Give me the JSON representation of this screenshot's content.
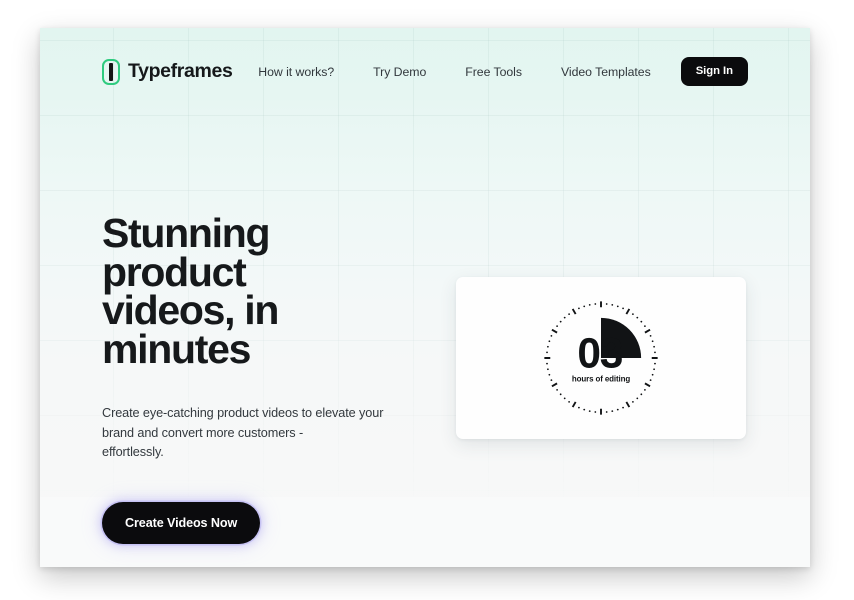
{
  "brand": {
    "name": "Typeframes",
    "logo_icon": "bracket-logo-icon",
    "logo_color": "#2fcb7f"
  },
  "nav": {
    "links": [
      {
        "label": "How it works?"
      },
      {
        "label": "Try Demo"
      },
      {
        "label": "Free Tools"
      },
      {
        "label": "Video Templates"
      }
    ],
    "signin_label": "Sign In"
  },
  "hero": {
    "title": "Stunning product videos, in minutes",
    "subtitle_line1": "Create eye-catching product videos to elevate your",
    "subtitle_line2": "brand and convert more customers -",
    "subtitle_line3": "effortlessly.",
    "cta_label": "Create Videos Now"
  },
  "video_card": {
    "clock_number": "03",
    "clock_caption": "hours of editing",
    "graphic_icon": "stopwatch-icon"
  },
  "colors": {
    "accent_green": "#2fcb7f",
    "button_black": "#0b0b0d",
    "text_dark": "#16191b",
    "text_body": "#33393e",
    "bg_top": "#e2f5f0",
    "bg_bottom": "#f8f9f9",
    "cta_glow": "#8c82f0"
  }
}
